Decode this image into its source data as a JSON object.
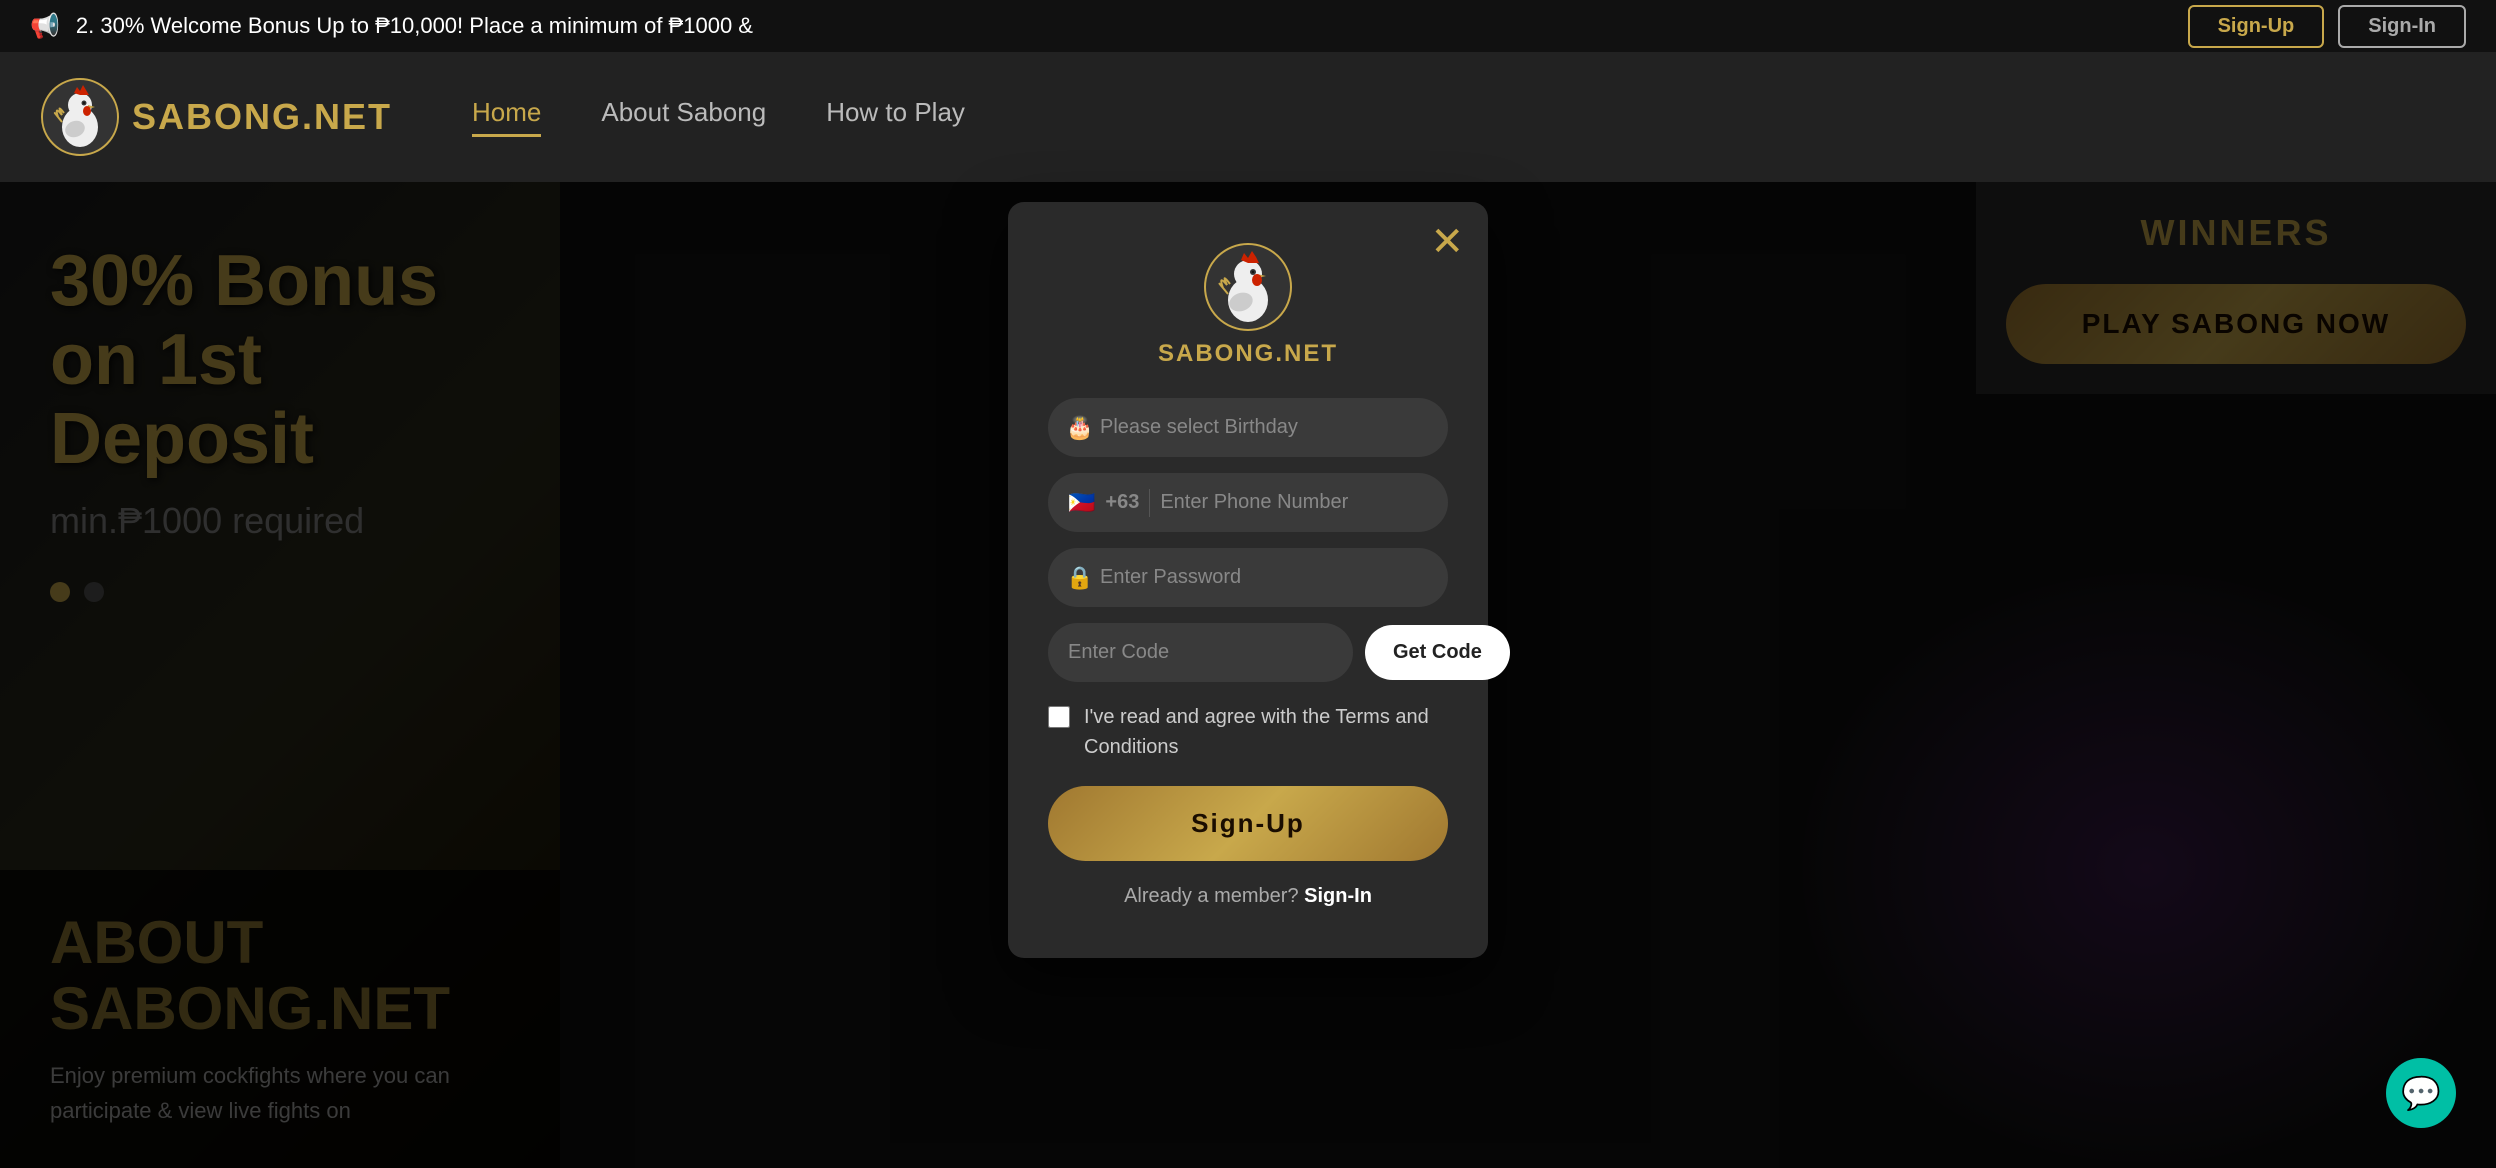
{
  "announcement": {
    "icon": "📢",
    "text": "2. 30% Welcome Bonus Up to ₱10,000! Place a minimum of ₱1000 &",
    "signup_label": "Sign-Up",
    "signin_label": "Sign-In"
  },
  "navbar": {
    "logo_text": "SABONG.NET",
    "links": [
      {
        "label": "Home",
        "active": true
      },
      {
        "label": "About Sabong",
        "active": false
      },
      {
        "label": "How to Play",
        "active": false
      }
    ]
  },
  "banner": {
    "line1": "30% Bonus",
    "line2": "on 1st Deposit",
    "line3": "min.₱1000 required"
  },
  "winners": {
    "title": "WINNERS",
    "play_button": "PLAY SABONG NOW"
  },
  "about": {
    "title_line1": "ABOUT",
    "title_line2": "SABONG.NET",
    "text": "Enjoy premium cockfights where you can participate & view live fights on"
  },
  "modal": {
    "logo_text": "SABONG.NET",
    "close_icon": "✕",
    "birthday_placeholder": "Please select Birthday",
    "phone_flag": "🇵🇭",
    "phone_code": "+63",
    "phone_placeholder": "Enter Phone Number",
    "password_placeholder": "Enter Password",
    "code_placeholder": "Enter Code",
    "get_code_label": "Get Code",
    "terms_text": "I've read and agree with the Terms and Conditions",
    "signup_label": "Sign-Up",
    "signin_prompt": "Already a member?",
    "signin_link": "Sign-In"
  },
  "chat": {
    "icon": "💬"
  }
}
